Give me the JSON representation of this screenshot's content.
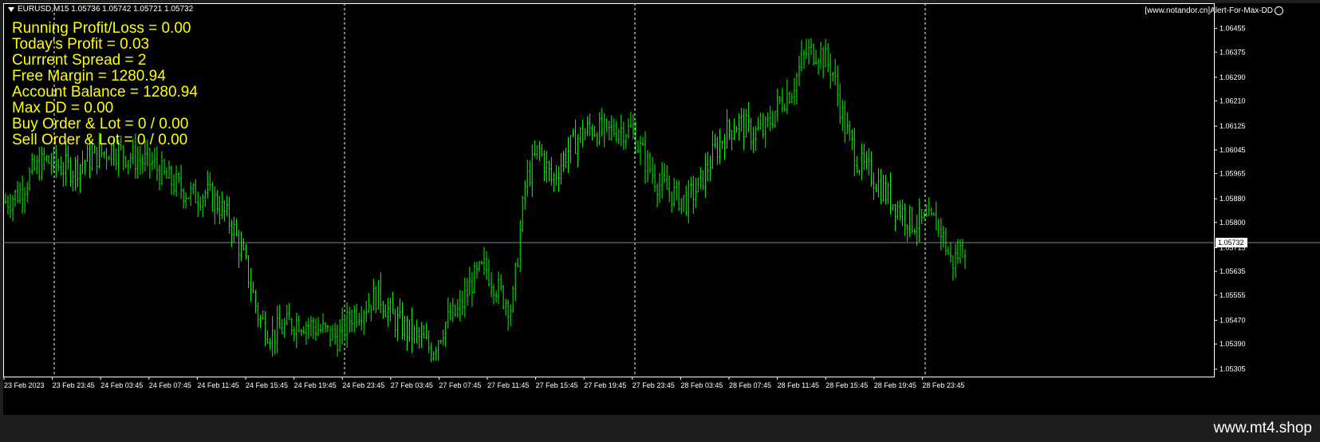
{
  "symbol_header": "EURUSD,M15  1.05736 1.05742 1.05721 1.05732",
  "overlay": [
    "Running Profit/Loss = 0.00",
    "Today's Profit = 0.03",
    "Currrent Spread = 2",
    "Free Margin = 1280.94",
    "Account Balance = 1280.94",
    "Max DD = 0.00",
    "Buy Order & Lot = 0 / 0.00",
    "Sell Order & Lot = 0 / 0.00"
  ],
  "ea_label": "[www.notandor.cn]Alert-For-Max-DD",
  "watermark": "www.mt4.shop",
  "current_price_label": "1.05732",
  "colors": {
    "candle": "#00ff00",
    "text_overlay": "#ffff00",
    "background": "#000000",
    "grid": "#ffffff",
    "price_line": "#778899"
  },
  "chart_data": {
    "type": "line",
    "ylim": [
      1.0528,
      1.0654
    ],
    "price_ticks": [
      "1.06455",
      "1.06375",
      "1.06290",
      "1.06210",
      "1.06125",
      "1.06045",
      "1.05965",
      "1.05880",
      "1.05800",
      "1.05715",
      "1.05635",
      "1.05555",
      "1.05470",
      "1.05390",
      "1.05305"
    ],
    "time_ticks": [
      "23 Feb 2023",
      "23 Feb 23:45",
      "24 Feb 03:45",
      "24 Feb 07:45",
      "24 Feb 11:45",
      "24 Feb 15:45",
      "24 Feb 19:45",
      "24 Feb 23:45",
      "27 Feb 03:45",
      "27 Feb 07:45",
      "27 Feb 11:45",
      "27 Feb 15:45",
      "27 Feb 19:45",
      "27 Feb 23:45",
      "28 Feb 03:45",
      "28 Feb 07:45",
      "28 Feb 11:45",
      "28 Feb 15:45",
      "28 Feb 19:45",
      "28 Feb 23:45"
    ],
    "current_price": 1.05732,
    "series": [
      {
        "values": [
          1.0587,
          1.059,
          1.0597,
          1.0601,
          1.0599,
          1.0598,
          1.0601,
          1.0603,
          1.0605,
          1.0603,
          1.0601,
          1.06,
          1.0595,
          1.0592,
          1.0589,
          1.059,
          1.0586,
          1.0579,
          1.0566,
          1.0548,
          1.0542,
          1.0545,
          1.0547,
          1.0545,
          1.0543,
          1.0541,
          1.0549,
          1.0552,
          1.0556,
          1.0548,
          1.0544,
          1.0541,
          1.0537,
          1.0546,
          1.055,
          1.056,
          1.0565,
          1.0557,
          1.0551,
          1.0593,
          1.0605,
          1.0594,
          1.0603,
          1.0609,
          1.0612,
          1.061,
          1.0612,
          1.0611,
          1.0601,
          1.0593,
          1.059,
          1.0587,
          1.0592,
          1.0602,
          1.061,
          1.0614,
          1.061,
          1.0611,
          1.062,
          1.0625,
          1.0637,
          1.0638,
          1.0632,
          1.0612,
          1.06,
          1.0596,
          1.059,
          1.0585,
          1.058,
          1.058,
          1.058,
          1.0566,
          1.0573
        ]
      }
    ]
  }
}
